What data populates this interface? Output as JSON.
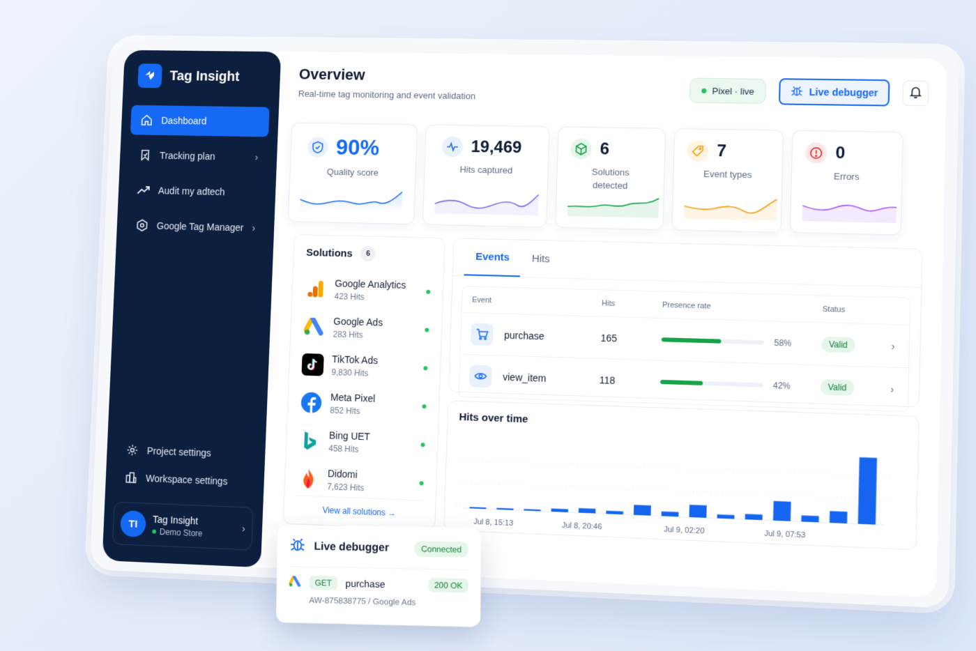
{
  "brand": {
    "name": "Tag Insight"
  },
  "sidebar": {
    "items": [
      {
        "label": "Dashboard",
        "active": true,
        "icon": "home-icon",
        "chevron": false
      },
      {
        "label": "Tracking plan",
        "active": false,
        "icon": "bookmark-icon",
        "chevron": true
      },
      {
        "label": "Audit my adtech",
        "active": false,
        "icon": "trend-icon",
        "chevron": false
      },
      {
        "label": "Google Tag Manager",
        "active": false,
        "icon": "gtm-icon",
        "chevron": true
      }
    ],
    "bottom": [
      {
        "label": "Project settings",
        "icon": "gear-icon"
      },
      {
        "label": "Workspace settings",
        "icon": "building-icon"
      }
    ],
    "user": {
      "initials": "TI",
      "name": "Tag Insight",
      "store": "Demo Store"
    }
  },
  "header": {
    "title": "Overview",
    "subtitle": "Real-time tag monitoring and event validation",
    "pixel_status": "Pixel · live",
    "debugger_label": "Live debugger"
  },
  "stats": [
    {
      "value": "90%",
      "label": "Quality score",
      "color": "#1569f5"
    },
    {
      "value": "19,469",
      "label": "Hits captured",
      "color": "#1569f5"
    },
    {
      "value": "6",
      "label": "Solutions detected",
      "color": "#16a34a"
    },
    {
      "value": "7",
      "label": "Event types",
      "color": "#f59e0b"
    },
    {
      "value": "0",
      "label": "Errors",
      "color": "#a855f7"
    }
  ],
  "solutions": {
    "title": "Solutions",
    "count": "6",
    "items": [
      {
        "name": "Google Analytics",
        "hits": "423 Hits"
      },
      {
        "name": "Google Ads",
        "hits": "283 Hits"
      },
      {
        "name": "TikTok Ads",
        "hits": "9,830 Hits"
      },
      {
        "name": "Meta Pixel",
        "hits": "852 Hits"
      },
      {
        "name": "Bing UET",
        "hits": "458 Hits"
      },
      {
        "name": "Didomi",
        "hits": "7,623 Hits"
      }
    ],
    "view_all": "View all solutions"
  },
  "events": {
    "tabs": [
      "Events",
      "Hits"
    ],
    "columns": [
      "Event",
      "Hits",
      "Presence rate",
      "Status"
    ],
    "rows": [
      {
        "event": "purchase",
        "hits": "165",
        "rate": 58,
        "rate_label": "58%",
        "status": "Valid",
        "icon": "cart-icon"
      },
      {
        "event": "view_item",
        "hits": "118",
        "rate": 42,
        "rate_label": "42%",
        "status": "Valid",
        "icon": "eye-icon"
      }
    ]
  },
  "hits_chart": {
    "title": "Hits over time",
    "x_labels": [
      "Jul 8, 15:13",
      "Jul 8, 20:46",
      "Jul 9, 02:20",
      "Jul 9, 07:53"
    ]
  },
  "chart_data": {
    "type": "bar",
    "values": [
      1,
      2,
      2,
      4,
      6,
      4,
      13,
      6,
      16,
      5,
      7,
      25,
      8,
      15,
      85
    ],
    "ylim": [
      0,
      90
    ]
  },
  "float_debugger": {
    "title": "Live debugger",
    "status": "Connected",
    "method": "GET",
    "event": "purchase",
    "code": "200 OK",
    "account": "AW-875838775",
    "separator": "/",
    "source": "Google Ads"
  }
}
